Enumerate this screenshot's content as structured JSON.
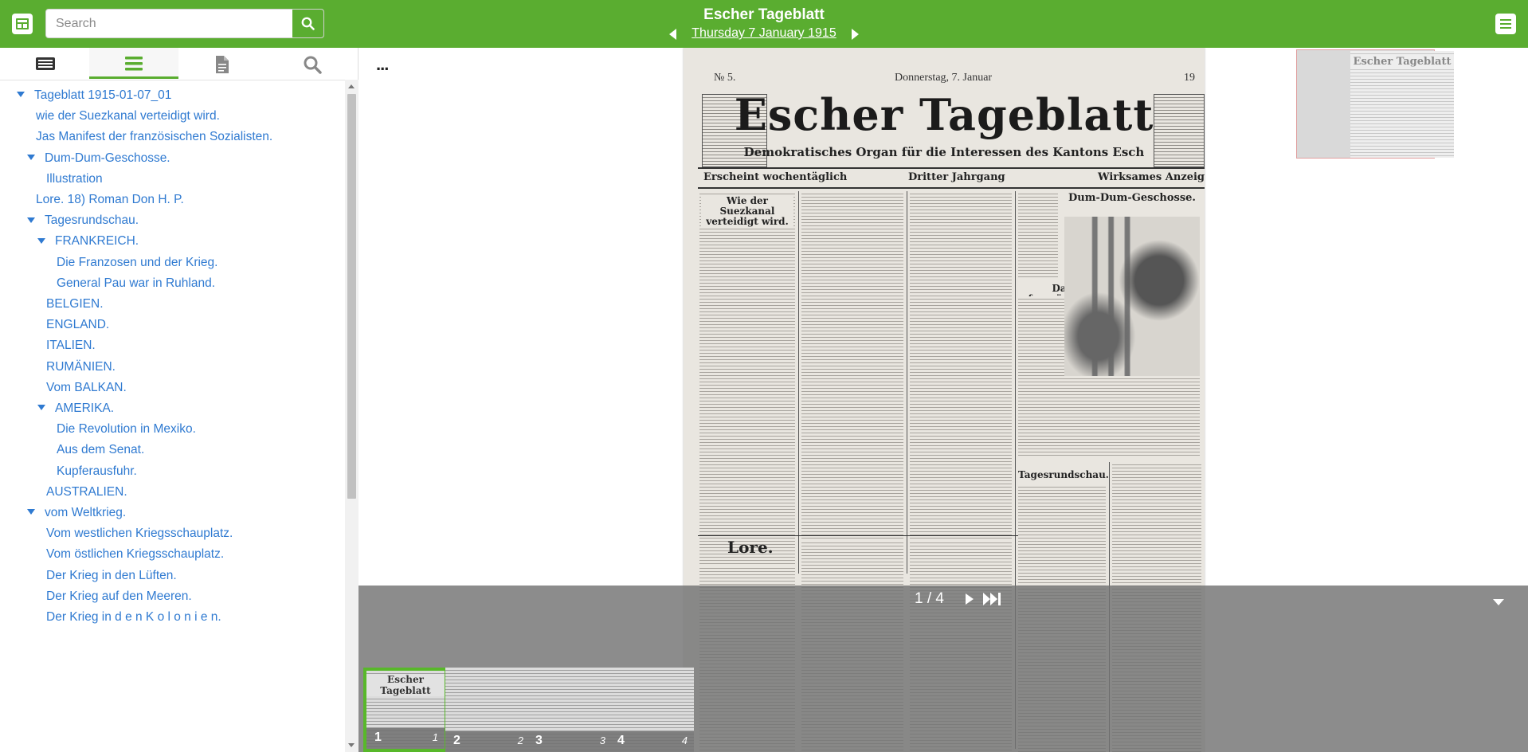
{
  "header": {
    "search_placeholder": "Search",
    "newspaper_title": "Escher Tageblatt",
    "issue_date": "Thursday 7 January 1915"
  },
  "sidebar": {
    "tabs": [
      {
        "name": "table-of-contents-tab",
        "icon": "newspaper-icon",
        "active": false
      },
      {
        "name": "structure-tab",
        "icon": "list-icon",
        "active": true
      },
      {
        "name": "article-text-tab",
        "icon": "document-icon",
        "active": false
      },
      {
        "name": "search-tab",
        "icon": "search-icon",
        "active": false
      }
    ],
    "tree": [
      {
        "label": "Tageblatt 1915-01-07_01",
        "level": 0,
        "expanded": true
      },
      {
        "label": "wie der Suezkanal verteidigt wird.",
        "level": 1
      },
      {
        "label": "Jas Manifest der französischen Sozialisten.",
        "level": 1
      },
      {
        "label": "Dum-Dum-Geschosse.",
        "level": 1,
        "expanded": true
      },
      {
        "label": "Illustration",
        "level": 2
      },
      {
        "label": "Lore. 18) Roman Don H. P.",
        "level": 1
      },
      {
        "label": "Tagesrundschau.",
        "level": 1,
        "expanded": true
      },
      {
        "label": "FRANKREICH.",
        "level": 2,
        "expanded": true
      },
      {
        "label": "Die Franzosen und der Krieg.",
        "level": 3
      },
      {
        "label": "General Pau war in Ruhland.",
        "level": 3
      },
      {
        "label": "BELGIEN.",
        "level": 2
      },
      {
        "label": "ENGLAND.",
        "level": 2
      },
      {
        "label": "ITALIEN.",
        "level": 2
      },
      {
        "label": "RUMÄNIEN.",
        "level": 2
      },
      {
        "label": "Vom BALKAN.",
        "level": 2
      },
      {
        "label": "AMERIKA.",
        "level": 2,
        "expanded": true
      },
      {
        "label": "Die Revolution in Mexiko.",
        "level": 3
      },
      {
        "label": "Aus dem Senat.",
        "level": 3
      },
      {
        "label": "Kupferausfuhr.",
        "level": 3
      },
      {
        "label": "AUSTRALIEN.",
        "level": 2
      },
      {
        "label": "vom Weltkrieg.",
        "level": 1,
        "expanded": true
      },
      {
        "label": "Vom westlichen Kriegsschauplatz.",
        "level": 2
      },
      {
        "label": "Vom östlichen Kriegsschauplatz.",
        "level": 2
      },
      {
        "label": "Der Krieg in den Lüften.",
        "level": 2
      },
      {
        "label": "Der Krieg auf den Meeren.",
        "level": 2
      },
      {
        "label": "Der Krieg in d e n K o l o n i e n.",
        "level": 2
      }
    ]
  },
  "viewer": {
    "more_label": "...",
    "page": {
      "number_text": "№ 5.",
      "date_text": "Donnerstag, 7. Januar",
      "year_text": "19",
      "masthead": "Escher Tageblatt",
      "subtitle": "Demokratisches Organ für die Interessen des Kantons Esch",
      "strip_left": "Erscheint wochentäglich",
      "strip_mid": "Dritter Jahrgang",
      "strip_right": "Wirksames Anzeigebla",
      "suez_heading": "Wie der Suezkanal verteidigt wird.",
      "dumdum_heading": "Dum-Dum-Geschosse.",
      "manifest_heading": "Das Manifest der französischen Sozialisten.",
      "lore_heading": "Lore.",
      "tages_heading": "Tagesrundschau."
    },
    "minimap_title": "Escher Tageblatt",
    "pager": {
      "counter": "1 / 4"
    },
    "thumbnails": [
      {
        "label": "1",
        "index": "1",
        "active": true
      },
      {
        "label": "2",
        "index": "2",
        "active": false
      },
      {
        "label": "3",
        "index": "3",
        "active": false
      },
      {
        "label": "4",
        "index": "4",
        "active": false
      }
    ]
  },
  "colors": {
    "brand_green": "#5aad30",
    "link_blue": "#2f7ad1",
    "active_thumb_border": "#58b82a"
  }
}
